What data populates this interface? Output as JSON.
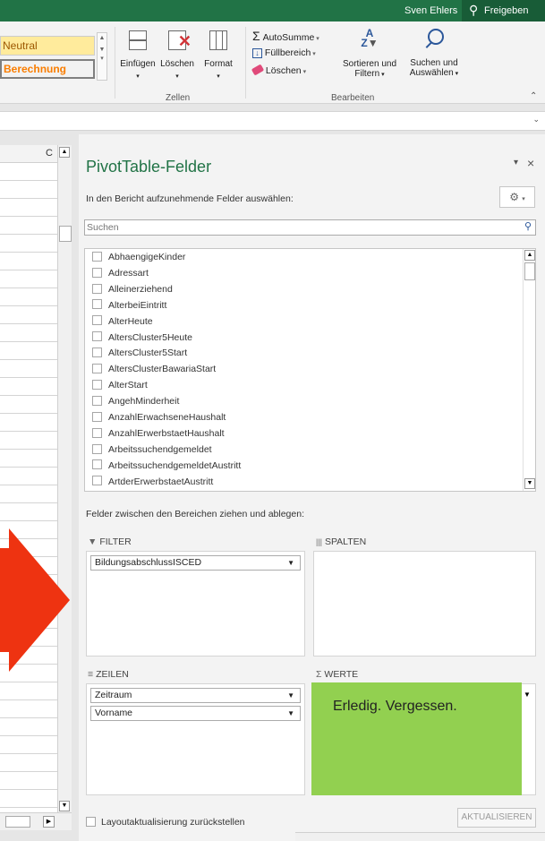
{
  "titlebar": {
    "user": "Sven Ehlers",
    "share": "Freigeben"
  },
  "styles": {
    "neutral": "Neutral",
    "calc": "Berechnung"
  },
  "ribbon": {
    "insert": "Einfügen",
    "delete": "Löschen",
    "format": "Format",
    "cells_group": "Zellen",
    "autosum": "AutoSumme",
    "fill": "Füllbereich",
    "clear": "Löschen",
    "sort": "Sortieren und",
    "sort2": "Filtern",
    "find": "Suchen und",
    "find2": "Auswählen",
    "edit_group": "Bearbeiten"
  },
  "grid": {
    "col_header": "C"
  },
  "pane": {
    "title": "PivotTable-Felder",
    "subtitle": "In den Bericht aufzunehmende Felder auswählen:",
    "search_placeholder": "Suchen",
    "fields": [
      "AbhaengigeKinder",
      "Adressart",
      "Alleinerziehend",
      "AlterbeiEintritt",
      "AlterHeute",
      "AltersCluster5Heute",
      "AltersCluster5Start",
      "AltersClusterBawariaStart",
      "AlterStart",
      "AngehMinderheit",
      "AnzahlErwachseneHaushalt",
      "AnzahlErwerbstaetHaushalt",
      "Arbeitssuchendgemeldet",
      "ArbeitssuchendgemeldetAustritt",
      "ArtderErwerbstaetAustritt"
    ],
    "drag_label": "Felder zwischen den Bereichen ziehen und ablegen:",
    "filter_label": "FILTER",
    "columns_label": "SPALTEN",
    "rows_label": "ZEILEN",
    "values_label": "WERTE",
    "filter_items": [
      "BildungsabschlussISCED"
    ],
    "row_items": [
      "Zeitraum",
      "Vorname"
    ],
    "defer_label": "Layoutaktualisierung zurückstellen",
    "update_button": "AKTUALISIEREN"
  },
  "note": {
    "text": "Erledig. Vergessen."
  },
  "colors": {
    "excel_green": "#217346",
    "arrow": "#ee3311",
    "note": "#92d050"
  }
}
